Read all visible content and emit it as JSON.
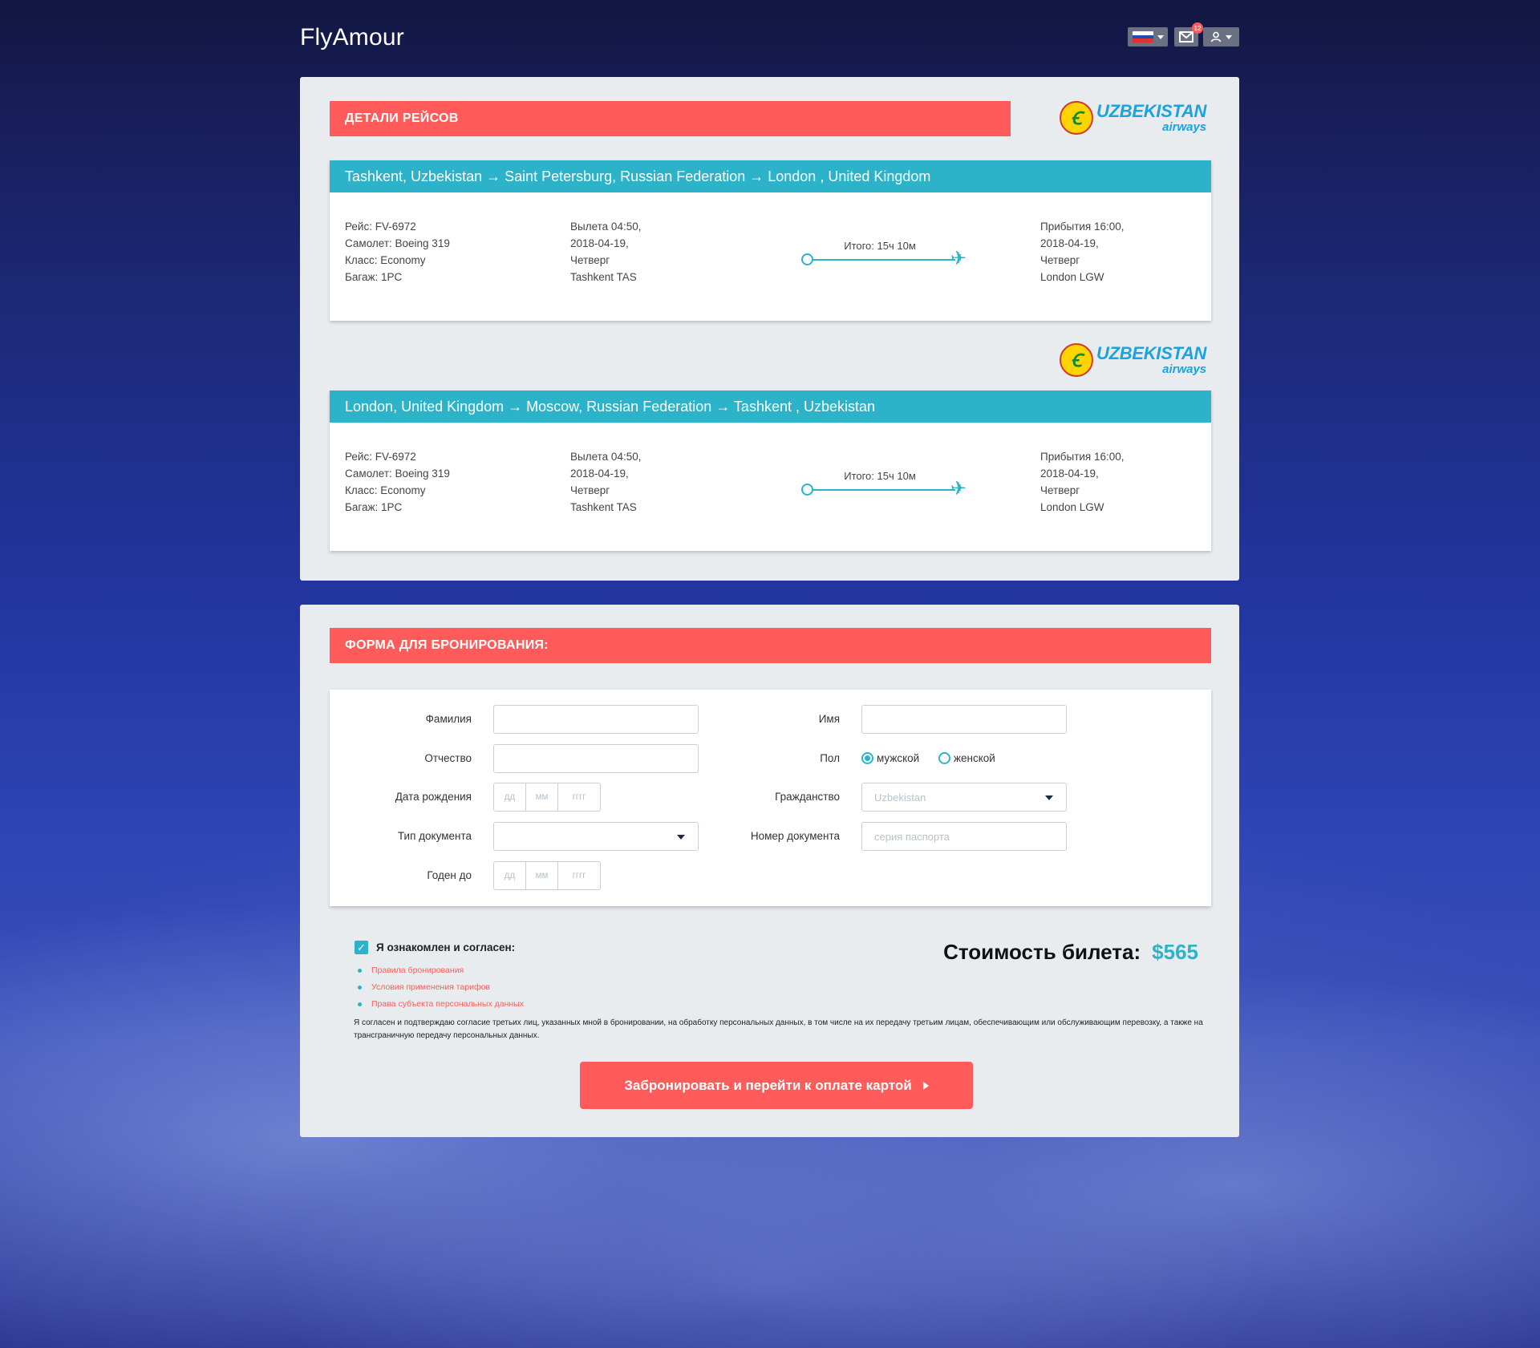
{
  "header": {
    "logo": "FlyAmour",
    "mail_badge": "12",
    "flag_colors": [
      "#ffffff",
      "#1f4bb5",
      "#e33030"
    ]
  },
  "flights_panel": {
    "title": "ДЕТАЛИ РЕЙСОВ",
    "airline": {
      "name": "UZBEKISTAN",
      "sub": "airways",
      "emblem": "Ꞓ"
    },
    "cards": [
      {
        "route": "Tashkent, Uzbekistan → Saint Petersburg, Russian Federation → London , United Kingdom",
        "info": [
          "Рейс: FV-6972",
          "Самолет: Boeing 319",
          "Класс: Economy",
          "Багаж: 1PC"
        ],
        "departure": [
          "Вылета 04:50,",
          "2018-04-19,",
          "Четверг",
          "Tashkent TAS"
        ],
        "total": "Итого: 15ч 10м",
        "arrival": [
          "Прибытия 16:00,",
          "2018-04-19,",
          "Четверг",
          "London LGW"
        ]
      },
      {
        "route": "London, United Kingdom → Moscow, Russian Federation → Tashkent , Uzbekistan",
        "info": [
          "Рейс: FV-6972",
          "Самолет: Boeing 319",
          "Класс: Economy",
          "Багаж: 1PC"
        ],
        "departure": [
          "Вылета 04:50,",
          "2018-04-19,",
          "Четверг",
          "Tashkent TAS"
        ],
        "total": "Итого: 15ч 10м",
        "arrival": [
          "Прибытия 16:00,",
          "2018-04-19,",
          "Четверг",
          "London LGW"
        ]
      }
    ]
  },
  "booking": {
    "title": "ФОРМА ДЛЯ БРОНИРОВАНИЯ:",
    "labels": {
      "last_name": "Фамилия",
      "first_name": "Имя",
      "patronymic": "Отчество",
      "gender": "Пол",
      "birth_date": "Дата рождения",
      "citizenship": "Гражданство",
      "doc_type": "Тип документа",
      "doc_number": "Номер документа",
      "valid_until": "Годен до"
    },
    "gender_options": [
      "мужской",
      "женской"
    ],
    "gender_selected": "мужской",
    "date_placeholders": [
      "дд",
      "мм",
      "гггг"
    ],
    "citizenship_value": "Uzbekistan",
    "doc_type_value": "",
    "doc_number_placeholder": "серия паспорта",
    "agree_label": "Я ознакомлен и согласен:",
    "links": [
      "Правила бронирования",
      "Условия применения тарифов",
      "Права субъекта персональных данных"
    ],
    "consent": "Я согласен и подтверждаю согласие третьих лиц, указанных мной в бронировании, на обработку персональных данных, в том числе на их передачу третьим лицам, обеспечивающим или обслуживающим перевозку, а также на трансграничную передачу персональных данных.",
    "price_label": "Стоимость билета:",
    "price_value": "$565",
    "submit_label": "Забронировать и перейти к оплате картой"
  },
  "colors": {
    "accent_red": "#ff5b5b",
    "accent_teal": "#2cb3c9"
  }
}
